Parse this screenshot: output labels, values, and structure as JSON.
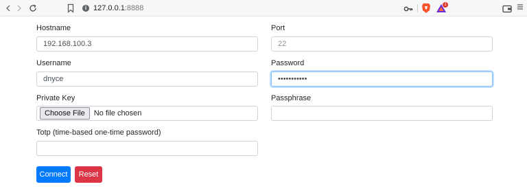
{
  "browser": {
    "url_host": "127.0.0.1",
    "url_port": ":8888",
    "rewards_count": "1"
  },
  "form": {
    "hostname": {
      "label": "Hostname",
      "value": "192.168.100.3"
    },
    "port": {
      "label": "Port",
      "placeholder": "22"
    },
    "username": {
      "label": "Username",
      "value": "dnyce"
    },
    "password": {
      "label": "Password",
      "masked_value": "•••••••••••"
    },
    "private_key": {
      "label": "Private Key",
      "button_label": "Choose File",
      "status": "No file chosen"
    },
    "passphrase": {
      "label": "Passphrase",
      "value": ""
    },
    "totp": {
      "label": "Totp (time-based one-time password)",
      "value": ""
    },
    "connect_label": "Connect",
    "reset_label": "Reset"
  },
  "colors": {
    "primary": "#007bff",
    "danger": "#dc3545",
    "focus": "#80bdff"
  }
}
